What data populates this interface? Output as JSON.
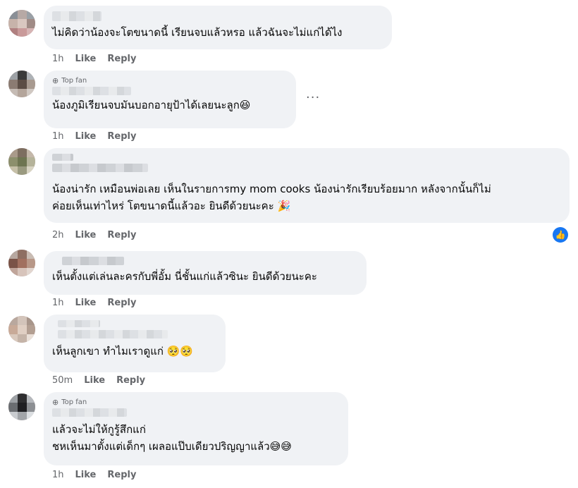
{
  "comments": [
    {
      "name": "Kiri Frusk",
      "text": "ไม่คิดว่าน้องจะโตขนาดนี้ เรียนจบแล้วหรอ แล้วฉันจะไม่แก่ได้ไง",
      "time": "1h",
      "like": "Like",
      "reply": "Reply"
    },
    {
      "badge": "Top fan",
      "name": "Asanya Thongmak",
      "text": "น้องภูมิเรียนจบมันบอกอายุป้าได้เลยนะลูก😆",
      "time": "1h",
      "like": "Like",
      "reply": "Reply",
      "more": "···"
    },
    {
      "line1": "น้องน่ารัก เหมือนพ่อเลย เห็นในรายการmy mom cooks น้องน่ารักเรียบร้อยมาก หลังจากนั้นก็ไม่",
      "line2": "ค่อยเห็นเท่าไหร่ โตขนาดนี้แล้วอะ ยินดีด้วยนะคะ 🎉",
      "time": "2h",
      "like": "Like",
      "reply": "Reply",
      "reaction_icon": "thumbs-up-icon"
    },
    {
      "text": "เห็นตั้งแต่เล่นละครกับพี่อั้ม นี่ชั้นแก่แล้วซินะ ยินดีด้วยนะคะ",
      "time": "1h",
      "like": "Like",
      "reply": "Reply"
    },
    {
      "text": "เห็นลูกเขา ทำไมเราดูแก่ 🥺🥺",
      "time": "50m",
      "like": "Like",
      "reply": "Reply"
    },
    {
      "badge": "Top fan",
      "line1": "แล้วจะไม่ให้กูรู้สึกแก่",
      "line2": "ชหเห็นมาตั้งแต่เด็กๆ เผลอแป๊บเดียวปริญญาแล้ว😅😅",
      "time": "1h",
      "like": "Like",
      "reply": "Reply"
    }
  ],
  "colors": {
    "bubble": "#f0f2f5",
    "meta": "#65676b",
    "text": "#050505",
    "accent": "#1877f2"
  }
}
